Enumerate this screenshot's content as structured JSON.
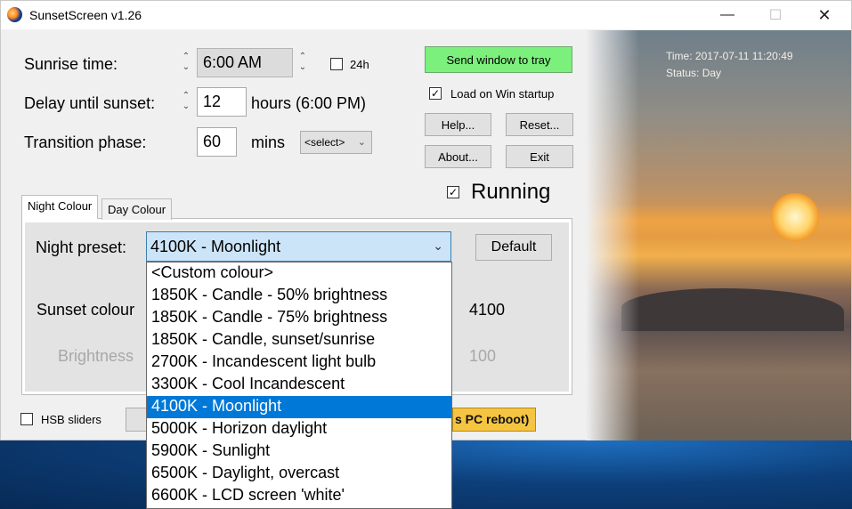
{
  "window": {
    "title": "SunsetScreen v1.26"
  },
  "titlebar_buttons": {
    "minimize": "—",
    "maximize": "☐",
    "close": "✕"
  },
  "settings": {
    "sunrise_label": "Sunrise time:",
    "sunrise_value": "6:00 AM",
    "mode24_label": "24h",
    "delay_label": "Delay until sunset:",
    "delay_value": "12",
    "delay_suffix": "hours  (6:00 PM)",
    "transition_label": "Transition phase:",
    "transition_value": "60",
    "transition_unit": "mins",
    "transition_select": "<select>"
  },
  "buttons": {
    "send_to_tray": "Send window to tray",
    "help": "Help...",
    "reset": "Reset...",
    "about": "About...",
    "exit": "Exit",
    "default": "Default"
  },
  "options": {
    "load_on_startup": "Load on Win startup",
    "running": "Running",
    "hsb_sliders": "HSB sliders"
  },
  "photo": {
    "time": "Time: 2017-07-11 11:20:49",
    "status": "Status: Day"
  },
  "tabs": [
    {
      "label": "Night Colour",
      "active": true
    },
    {
      "label": "Day Colour",
      "active": false
    }
  ],
  "night": {
    "preset_label": "Night preset:",
    "preset_value": "4100K - Moonlight",
    "sunset_colour_label": "Sunset colour",
    "sunset_colour_value": "4100",
    "brightness_label": "Brightness",
    "brightness_value": "100"
  },
  "dropdown_items": [
    "<Custom colour>",
    "1850K - Candle - 50% brightness",
    "1850K - Candle - 75% brightness",
    "1850K - Candle, sunset/sunrise",
    "2700K - Incandescent light bulb",
    "3300K - Cool Incandescent",
    "4100K - Moonlight",
    "5000K - Horizon daylight",
    "5900K - Sunlight",
    "6500K - Daylight, overcast",
    "6600K - LCD screen 'white'"
  ],
  "dropdown_selected_index": 6,
  "partial_button_text": "s PC reboot)",
  "colors": {
    "selection": "#0078d7",
    "tray_button": "#7cf07c",
    "warning": "#f5c542"
  }
}
